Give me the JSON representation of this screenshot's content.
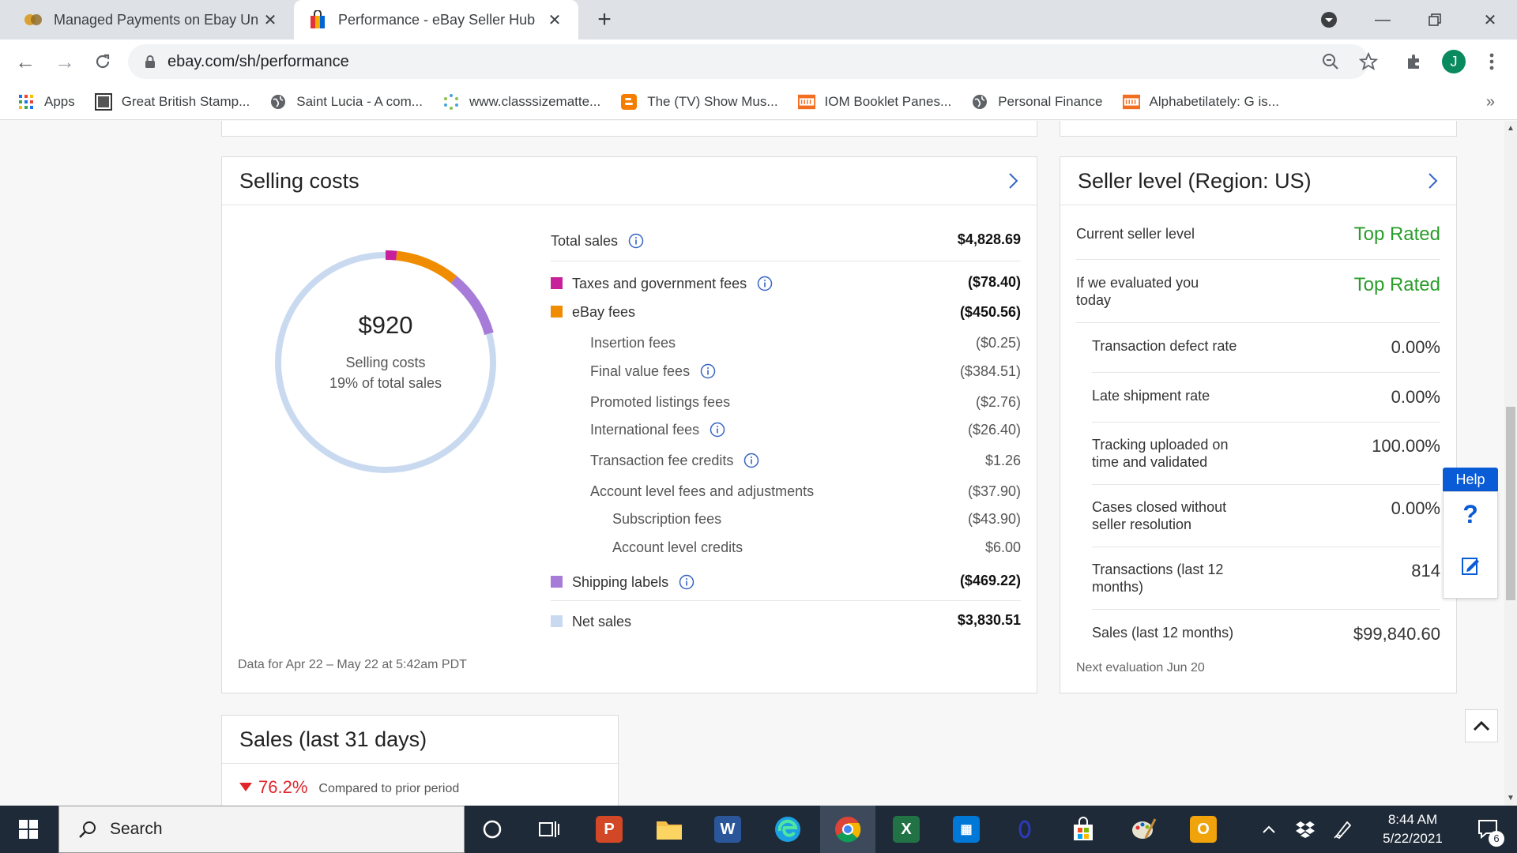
{
  "browser": {
    "tabs": [
      {
        "title": "Managed Payments on Ebay Unm",
        "active": false
      },
      {
        "title": "Performance - eBay Seller Hub",
        "active": true
      }
    ],
    "url": "ebay.com/sh/performance",
    "avatar_letter": "J",
    "bookmarks": [
      {
        "label": "Apps",
        "icon": "apps-grid-icon"
      },
      {
        "label": "Great British Stamp...",
        "icon": "gbs-icon"
      },
      {
        "label": "Saint Lucia - A com...",
        "icon": "globe-icon"
      },
      {
        "label": "www.classsizematte...",
        "icon": "dots-icon"
      },
      {
        "label": "The (TV) Show Mus...",
        "icon": "blogger-icon"
      },
      {
        "label": "IOM Booklet Panes...",
        "icon": "rit-icon"
      },
      {
        "label": "Personal Finance",
        "icon": "globe-icon"
      },
      {
        "label": "Alphabetilately: G is...",
        "icon": "rit-icon"
      }
    ],
    "overflow": "»"
  },
  "selling_costs": {
    "title": "Selling costs",
    "donut": {
      "amount": "$920",
      "label": "Selling costs",
      "sublabel": "19% of total sales",
      "segments": [
        {
          "name": "Taxes and government fees",
          "value": 78.4,
          "color": "#c8209a"
        },
        {
          "name": "eBay fees",
          "value": 450.56,
          "color": "#f08c00"
        },
        {
          "name": "Shipping labels",
          "value": 469.22,
          "color": "#a77bd8"
        },
        {
          "name": "Net sales",
          "value": 3830.51,
          "color": "#c9daf0"
        }
      ]
    },
    "total_sales": {
      "label": "Total sales",
      "value": "$4,828.69"
    },
    "taxes": {
      "label": "Taxes and government fees",
      "value": "($78.40)"
    },
    "ebay_fees": {
      "label": "eBay fees",
      "value": "($450.56)"
    },
    "insertion": {
      "label": "Insertion fees",
      "value": "($0.25)"
    },
    "final_value": {
      "label": "Final value fees",
      "value": "($384.51)"
    },
    "promoted": {
      "label": "Promoted listings fees",
      "value": "($2.76)"
    },
    "international": {
      "label": "International fees",
      "value": "($26.40)"
    },
    "tx_credits": {
      "label": "Transaction fee credits",
      "value": "$1.26"
    },
    "account_level": {
      "label": "Account level fees and adjustments",
      "value": "($37.90)"
    },
    "subscription": {
      "label": "Subscription fees",
      "value": "($43.90)"
    },
    "account_credits": {
      "label": "Account level credits",
      "value": "$6.00"
    },
    "shipping": {
      "label": "Shipping labels",
      "value": "($469.22)"
    },
    "net_sales": {
      "label": "Net sales",
      "value": "$3,830.51"
    },
    "footnote": "Data for Apr 22 – May 22 at 5:42am PDT"
  },
  "seller_level": {
    "title": "Seller level (Region: US)",
    "current": {
      "label": "Current seller level",
      "value": "Top Rated"
    },
    "evaluated": {
      "label": "If we evaluated you today",
      "value": "Top Rated"
    },
    "defect": {
      "label": "Transaction defect rate",
      "value": "0.00%"
    },
    "late": {
      "label": "Late shipment rate",
      "value": "0.00%"
    },
    "tracking": {
      "label": "Tracking uploaded on time and validated",
      "value": "100.00%"
    },
    "cases": {
      "label": "Cases closed without seller resolution",
      "value": "0.00%"
    },
    "transactions": {
      "label": "Transactions (last 12 months)",
      "value": "814"
    },
    "sales12": {
      "label": "Sales (last 12 months)",
      "value": "$99,840.60"
    },
    "footnote": "Next evaluation Jun 20"
  },
  "sales31": {
    "title": "Sales (last 31 days)",
    "change": "76.2%",
    "compare": "Compared to prior period"
  },
  "help": {
    "label": "Help",
    "question": "?"
  },
  "taskbar": {
    "search_placeholder": "Search",
    "time": "8:44 AM",
    "date": "5/22/2021",
    "notifications": "6"
  },
  "colors": {
    "accent_blue": "#0a5bd6",
    "top_rated_green": "#2a9d2a",
    "negative_red": "#e0252b"
  }
}
